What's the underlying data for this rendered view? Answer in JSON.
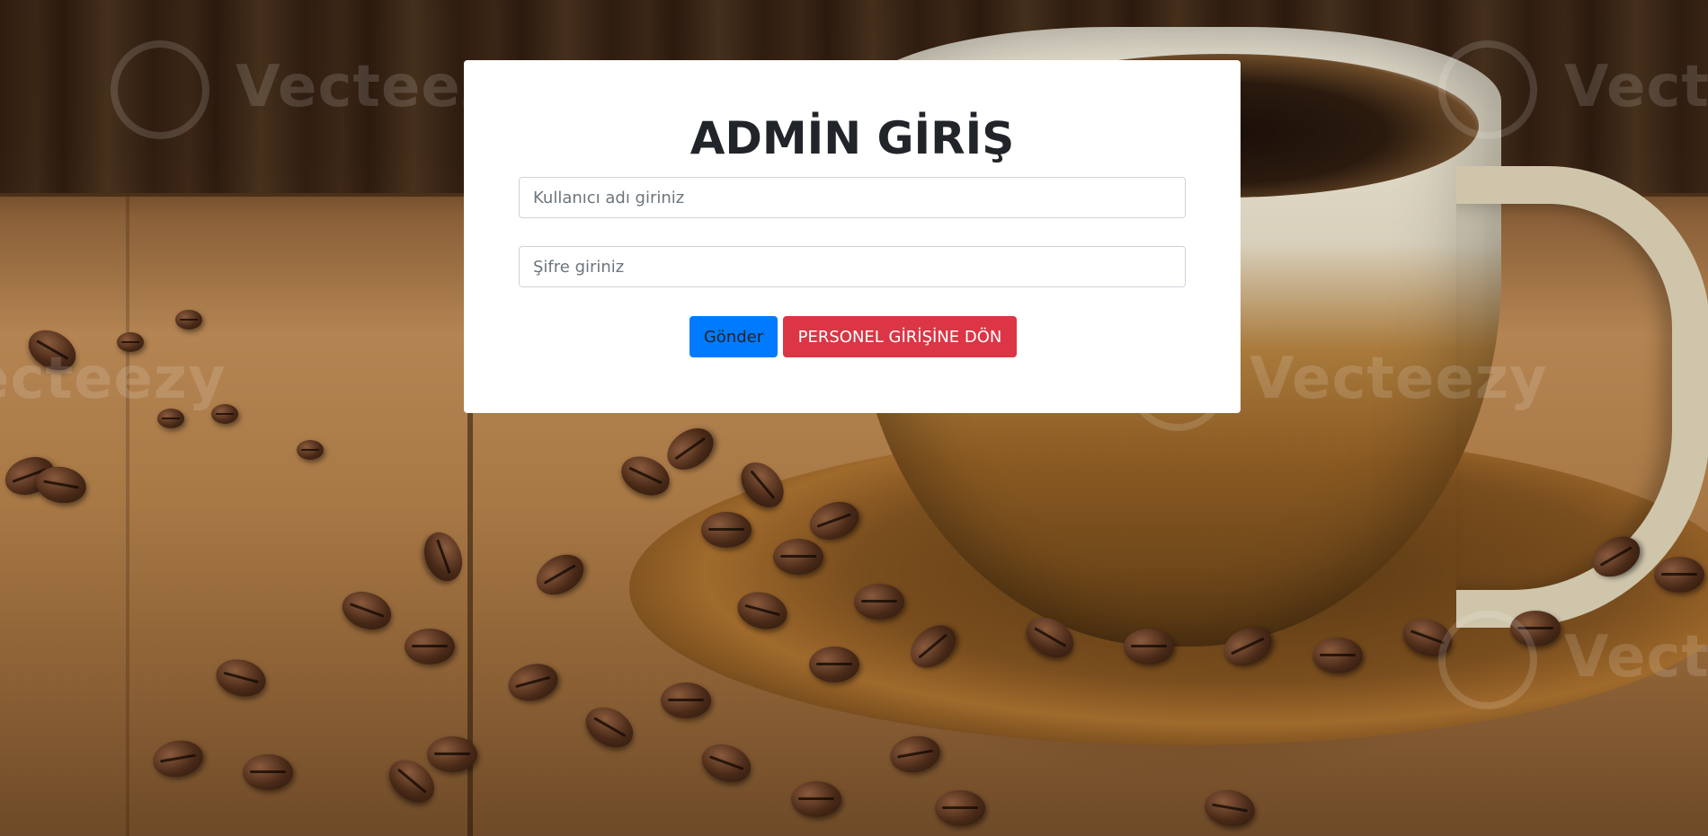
{
  "login": {
    "title": "ADMİN GİRİŞ",
    "username_placeholder": "Kullanıcı adı giriniz",
    "username_value": "",
    "password_placeholder": "Şifre giriniz",
    "password_value": "",
    "submit_label": "Gönder",
    "back_label": "PERSONEL GİRİŞİNE DÖN"
  },
  "background": {
    "description_icon": "coffee-background-image",
    "watermark_text": "Vecteezy"
  },
  "colors": {
    "card_bg": "#ffffff",
    "title_text": "#212529",
    "submit_bg": "#007bff",
    "back_bg": "#dc3545",
    "back_text": "#ffffff"
  }
}
